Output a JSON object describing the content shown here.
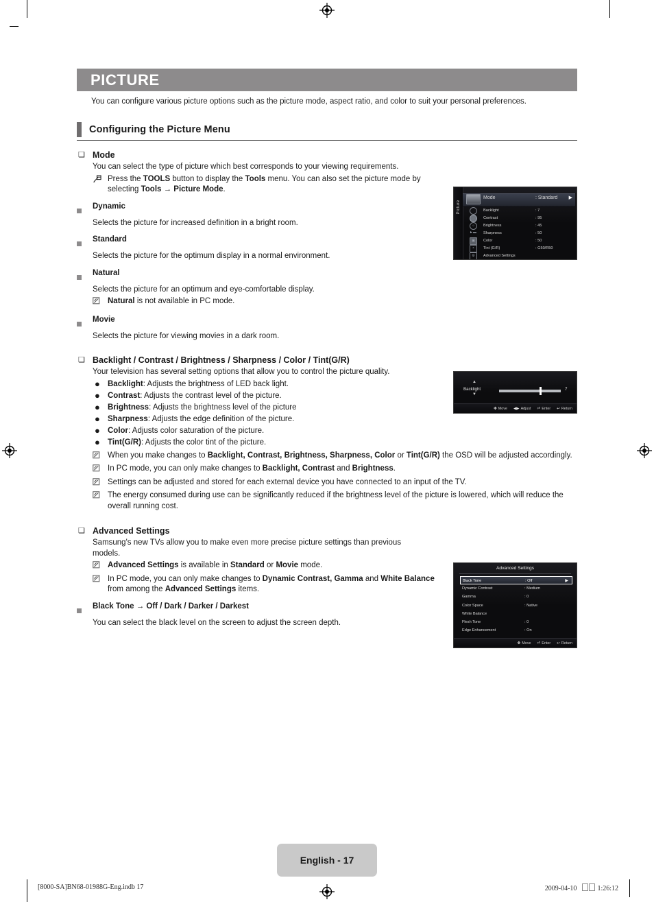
{
  "chapter": {
    "title": "PICTURE",
    "description": "You can configure various picture options such as the picture mode, aspect ratio, and color to suit your personal preferences."
  },
  "section": {
    "title": "Configuring the Picture Menu"
  },
  "mode": {
    "marker": "❑",
    "heading": "Mode",
    "intro": "You can select the type of picture which best corresponds to your viewing requirements.",
    "tools_note": "Press the TOOLS button to display the Tools menu. You can also set the picture mode by selecting Tools → Picture Mode.",
    "tools_note_parts": {
      "a": "Press the ",
      "b_tools_key": "TOOLS",
      "c": " button to display the ",
      "d_tools_menu": "Tools",
      "e": " menu. You can also set the picture mode by selecting ",
      "f_tools": "Tools → Picture Mode",
      "g": "."
    },
    "items": [
      {
        "name": "Dynamic",
        "desc": "Selects the picture for increased definition in a bright room."
      },
      {
        "name": "Standard",
        "desc": "Selects the picture for the optimum display in a normal environment."
      },
      {
        "name": "Natural",
        "desc": "Selects the picture for an optimum and eye-comfortable display.",
        "note_bold": "Natural",
        "note_rest": " is not available in PC mode."
      },
      {
        "name": "Movie",
        "desc": "Selects the picture for viewing movies in a dark room."
      }
    ]
  },
  "controls": {
    "marker": "❑",
    "heading": "Backlight / Contrast / Brightness / Sharpness / Color / Tint(G/R)",
    "intro": "Your television has several setting options that allow you to control the picture quality.",
    "bullets": [
      {
        "term": "Backlight",
        "desc": ": Adjusts the brightness of LED back light."
      },
      {
        "term": "Contrast",
        "desc": ": Adjusts the contrast level of the picture."
      },
      {
        "term": "Brightness",
        "desc": ": Adjusts the brightness level of the picture"
      },
      {
        "term": "Sharpness",
        "desc": ": Adjusts the edge definition of the picture."
      },
      {
        "term": "Color",
        "desc": ": Adjusts color saturation of the picture."
      },
      {
        "term": "Tint(G/R)",
        "desc": ": Adjusts the color tint of the picture."
      }
    ],
    "notes": [
      {
        "p1": "When you make changes to ",
        "b1": "Backlight, Contrast, Brightness, Sharpness, Color",
        "p2": " or ",
        "b2": "Tint(G/R)",
        "p3": " the OSD will be adjusted accordingly."
      },
      {
        "p1": "In PC mode, you can only make changes to ",
        "b1": "Backlight, Contrast",
        "p2": " and ",
        "b2": "Brightness",
        "p3": "."
      },
      {
        "p1": "Settings can be adjusted and stored for each external device you have connected to an input of the TV.",
        "b1": "",
        "p2": "",
        "b2": "",
        "p3": ""
      },
      {
        "p1": "The energy consumed during use can be significantly reduced if the brightness level of the picture is lowered, which will reduce the overall running cost.",
        "b1": "",
        "p2": "",
        "b2": "",
        "p3": ""
      }
    ]
  },
  "advanced": {
    "marker": "❑",
    "heading": "Advanced Settings",
    "intro": "Samsung's new TVs allow you to make even more precise picture settings than previous models.",
    "notes": [
      {
        "p1": "",
        "b1": "Advanced Settings",
        "p2": " is available in ",
        "b2": "Standard",
        "p3": " or ",
        "b3": "Movie",
        "p4": " mode."
      },
      {
        "p1": "In PC mode, you can only make changes to ",
        "b1": "Dynamic Contrast, Gamma",
        "p2": " and ",
        "b2": "White Balance",
        "p3": " from among the ",
        "b3": "Advanced Settings",
        "p4": " items."
      }
    ],
    "black_tone": {
      "heading": "Black Tone → Off / Dark / Darker / Darkest",
      "desc": "You can select the black level on the screen to adjust the screen depth."
    }
  },
  "osd_picture": {
    "tab_label": "Picture",
    "selected_row": {
      "label": "Mode",
      "value": ": Standard",
      "arrow": "▶"
    },
    "rows": [
      {
        "label": "Backlight",
        "value": ": 7",
        "icon": "circle-icon"
      },
      {
        "label": "Contrast",
        "value": ": 95",
        "icon": "contrast-icon"
      },
      {
        "label": "Brightness",
        "value": ": 45",
        "icon": "brightness-icon"
      },
      {
        "label": "Sharpness",
        "value": ": 50",
        "icon": "sharpness-icon"
      },
      {
        "label": "Color",
        "value": ": 50",
        "icon": "color-icon"
      },
      {
        "label": "Tint (G/R)",
        "value": ": G50/R50",
        "icon": "tint-icon"
      },
      {
        "label": "Advanced Settings",
        "value": "",
        "icon": "advanced-icon"
      }
    ]
  },
  "osd_backlight": {
    "name": "Backlight",
    "up_arrow": "▲",
    "down_arrow": "▼",
    "value": "7",
    "slider_percent": 66,
    "footer": [
      {
        "glyph": "✤",
        "label": "Move"
      },
      {
        "glyph": "◀▶",
        "label": "Adjust"
      },
      {
        "glyph": "⏎",
        "label": "Enter"
      },
      {
        "glyph": "↩",
        "label": "Return"
      }
    ]
  },
  "osd_advanced": {
    "title": "Advanced Settings",
    "rows": [
      {
        "label": "Black Tone",
        "value": ": Off",
        "selected": true,
        "arrow": "▶"
      },
      {
        "label": "Dynamic Contrast",
        "value": ": Medium",
        "selected": false,
        "arrow": ""
      },
      {
        "label": "Gamma",
        "value": ": 0",
        "selected": false,
        "arrow": ""
      },
      {
        "label": "Color Space",
        "value": ": Native",
        "selected": false,
        "arrow": ""
      },
      {
        "label": "White Balance",
        "value": "",
        "selected": false,
        "arrow": ""
      },
      {
        "label": "Flesh Tone",
        "value": ": 0",
        "selected": false,
        "arrow": ""
      },
      {
        "label": "Edge Enhancement",
        "value": ": On",
        "selected": false,
        "arrow": ""
      }
    ],
    "footer": [
      {
        "glyph": "✤",
        "label": "Move"
      },
      {
        "glyph": "⏎",
        "label": "Enter"
      },
      {
        "glyph": "↩",
        "label": "Return"
      }
    ]
  },
  "footer": {
    "page_label": "English - 17",
    "file_info": "[8000-SA]BN68-01988G-Eng.indb   17",
    "timestamp_date": "2009-04-10",
    "timestamp_time": "1:26:12"
  },
  "colors": {
    "chapter_bar": "#8d8b8c",
    "section_tick": "#6f6d6e",
    "square_marker": "#8d8b8c",
    "page_badge": "#c9c9c9",
    "osd_background": "#0c0c0e",
    "osd_highlight": "#3a3f4c"
  }
}
